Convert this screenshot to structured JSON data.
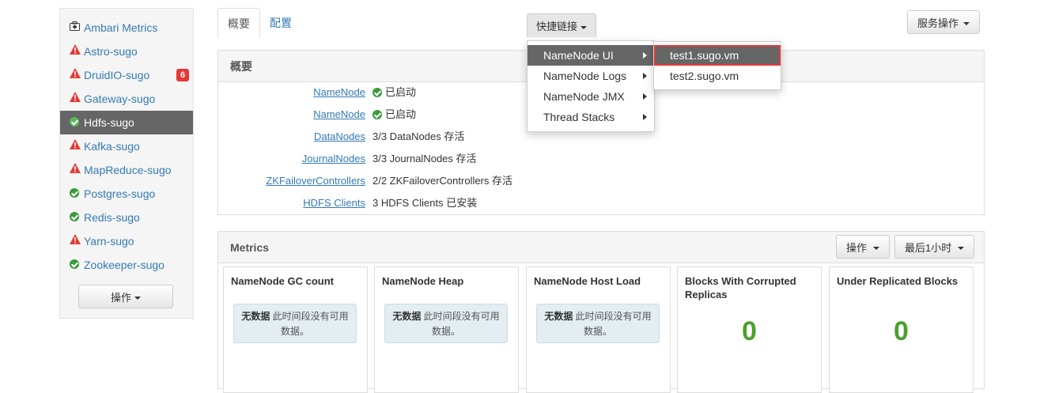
{
  "sidebar": {
    "items": [
      {
        "label": "Ambari Metrics",
        "status": "metrics"
      },
      {
        "label": "Astro-sugo",
        "status": "alert"
      },
      {
        "label": "DruidIO-sugo",
        "status": "alert",
        "badge": "6"
      },
      {
        "label": "Gateway-sugo",
        "status": "alert"
      },
      {
        "label": "Hdfs-sugo",
        "status": "ok"
      },
      {
        "label": "Kafka-sugo",
        "status": "alert"
      },
      {
        "label": "MapReduce-sugo",
        "status": "alert"
      },
      {
        "label": "Postgres-sugo",
        "status": "ok"
      },
      {
        "label": "Redis-sugo",
        "status": "ok"
      },
      {
        "label": "Yarn-sugo",
        "status": "alert"
      },
      {
        "label": "Zookeeper-sugo",
        "status": "ok"
      }
    ],
    "actions_label": "操作"
  },
  "tabs": [
    "概要",
    "配置"
  ],
  "quick_links_label": "快捷链接",
  "service_actions_label": "服务操作",
  "quick_links_menu": [
    "NameNode UI",
    "NameNode Logs",
    "NameNode JMX",
    "Thread Stacks"
  ],
  "quick_links_submenu": [
    "test1.sugo.vm",
    "test2.sugo.vm"
  ],
  "summary": {
    "title": "概要",
    "rows": [
      {
        "key": "NameNode",
        "value": "已启动"
      },
      {
        "key": "NameNode",
        "value": "已启动"
      },
      {
        "key": "DataNodes",
        "value": "3/3 DataNodes 存活"
      },
      {
        "key": "JournalNodes",
        "value": "3/3 JournalNodes 存活"
      },
      {
        "key": "ZKFailoverControllers",
        "value": "2/2 ZKFailoverControllers 存活"
      },
      {
        "key": "HDFS Clients",
        "value": "3 HDFS Clients 已安装"
      }
    ]
  },
  "metrics": {
    "title": "Metrics",
    "actions_label": "操作",
    "range_label": "最后1小时",
    "no_data_bold": "无数据",
    "no_data_line1": "此时间段没有可用",
    "no_data_line2": "数据。",
    "cards": [
      {
        "title": "NameNode GC count"
      },
      {
        "title": "NameNode Heap"
      },
      {
        "title": "NameNode Host Load"
      },
      {
        "title": "Blocks With Corrupted Replicas",
        "value": "0"
      },
      {
        "title": "Under Replicated Blocks",
        "value": "0"
      }
    ]
  },
  "colors": {
    "link": "#337ab7",
    "alert": "#e53935",
    "ok": "#3c9a3c",
    "number": "#4aa02c"
  }
}
